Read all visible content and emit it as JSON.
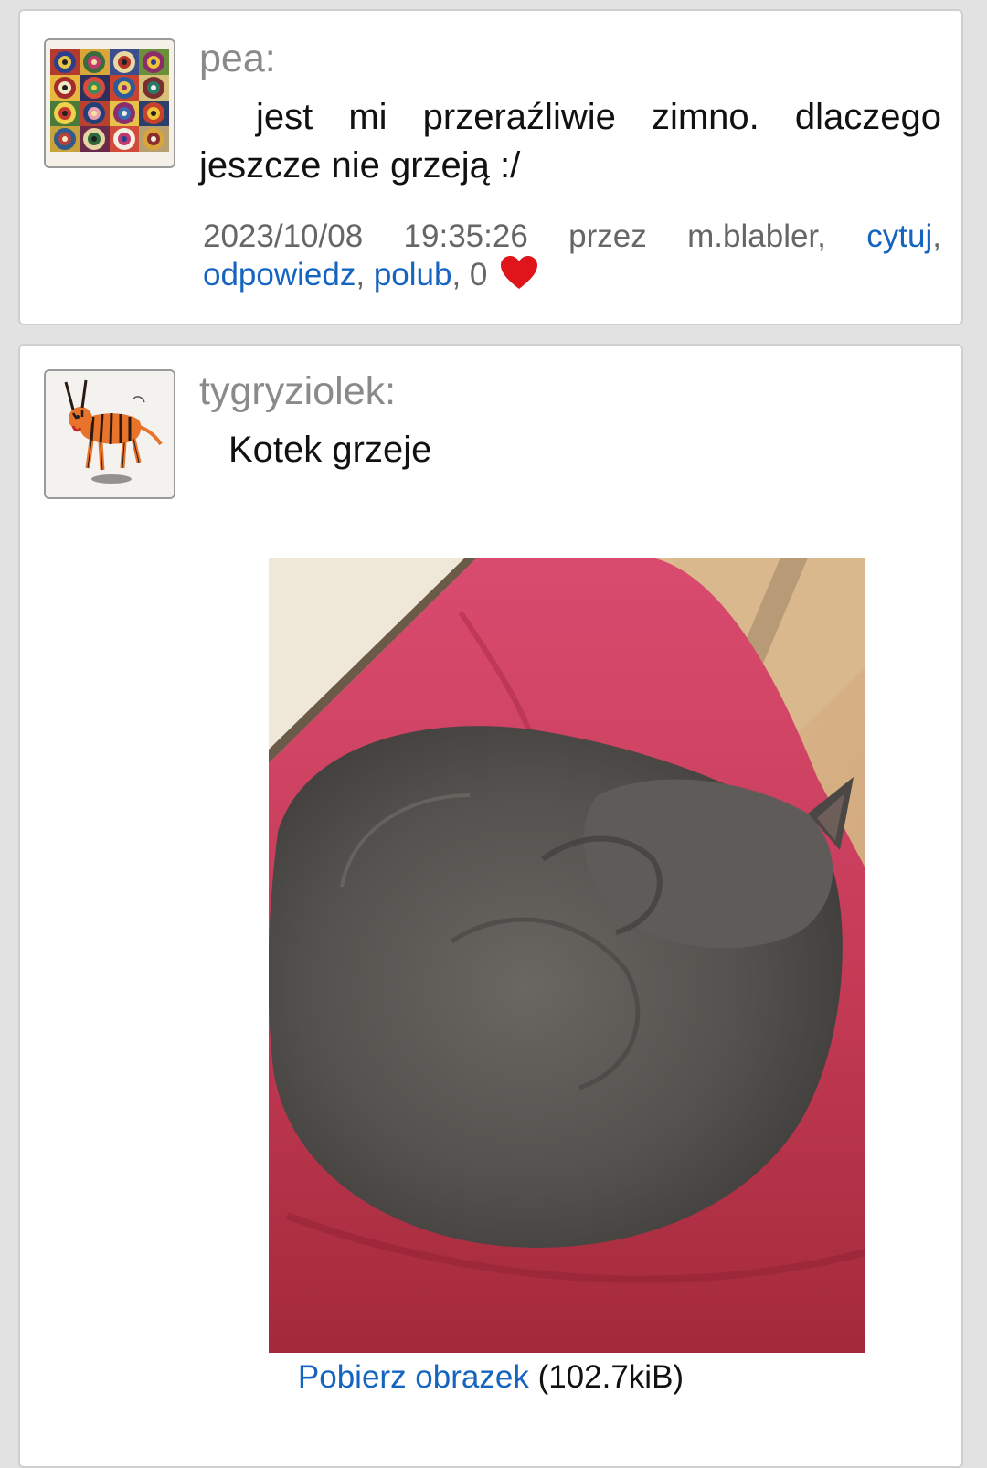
{
  "posts": [
    {
      "author": "pea:",
      "avatar_icon": "abstract-circles-painting-avatar",
      "message": "jest mi przeraźliwie zimno. dlaczego jeszcze nie grzeją :/",
      "meta": {
        "date": "2023/10/08",
        "time": "19:35:26",
        "via_label": "przez",
        "client": "m.blabler,",
        "quote_link": "cytuj",
        "reply_link": "odpowiedz",
        "like_link": "polub",
        "likes_count": "0",
        "heart_icon": "heart-icon",
        "heart_color": "#e0151b"
      }
    },
    {
      "author": "tygryziolek:",
      "avatar_icon": "tiger-drawing-avatar",
      "message": "Kotek grzeje",
      "image_icon": "sleeping-gray-cat-photo",
      "download_link": "Pobierz obrazek",
      "download_size": "(102.7kiB)"
    }
  ],
  "colors": {
    "link": "#1565c0",
    "author": "#8a8a8a",
    "meta": "#666666",
    "background": "#e2e2e2",
    "card": "#ffffff"
  }
}
